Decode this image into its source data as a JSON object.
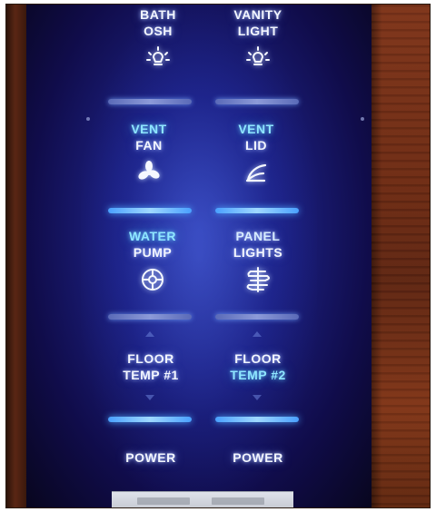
{
  "buttons": [
    {
      "id": "bath",
      "line1": "BATH",
      "line2": "OSH",
      "icon": "light-bulb-icon"
    },
    {
      "id": "vanity",
      "line1": "VANITY",
      "line2": "LIGHT",
      "icon": "light-bulb-icon"
    },
    {
      "id": "vent-fan",
      "line1": "VENT",
      "line2": "FAN",
      "icon": "fan-icon"
    },
    {
      "id": "vent-lid",
      "line1": "VENT",
      "line2": "LID",
      "icon": "lid-icon"
    },
    {
      "id": "water-pump",
      "line1": "WATER",
      "line2": "PUMP",
      "icon": "water-pump-icon"
    },
    {
      "id": "panel-lights",
      "line1": "PANEL",
      "line2": "LIGHTS",
      "icon": "heater-coil-icon"
    },
    {
      "id": "floor-temp-1",
      "line1": "FLOOR",
      "line2": "TEMP #1"
    },
    {
      "id": "floor-temp-2",
      "line1": "FLOOR",
      "line2": "TEMP #2"
    },
    {
      "id": "power-left",
      "line1": "POWER"
    },
    {
      "id": "power-right",
      "line1": "POWER"
    }
  ],
  "colors": {
    "panel_blue": "#1c2080",
    "label_white": "#f3f6ff",
    "label_cyan": "#8fe6ff",
    "bar_bright": "#6fbcff",
    "wood": "#6a2a14"
  }
}
